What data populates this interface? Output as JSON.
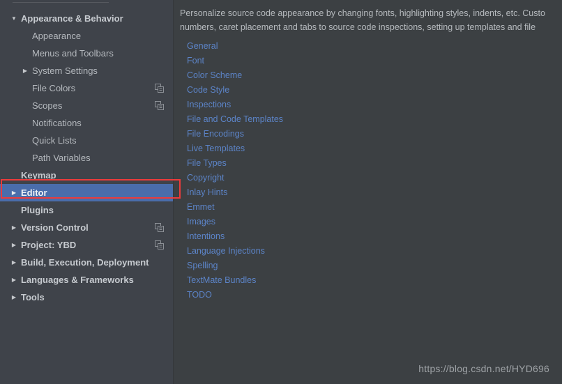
{
  "sidebar": {
    "items": [
      {
        "label": "Appearance & Behavior",
        "level": 0,
        "twisty": "down",
        "selected": false,
        "copy": false
      },
      {
        "label": "Appearance",
        "level": 1,
        "twisty": "none",
        "selected": false,
        "copy": false
      },
      {
        "label": "Menus and Toolbars",
        "level": 1,
        "twisty": "none",
        "selected": false,
        "copy": false
      },
      {
        "label": "System Settings",
        "level": 1,
        "twisty": "right",
        "selected": false,
        "copy": false
      },
      {
        "label": "File Colors",
        "level": 1,
        "twisty": "none",
        "selected": false,
        "copy": true
      },
      {
        "label": "Scopes",
        "level": 1,
        "twisty": "none",
        "selected": false,
        "copy": true
      },
      {
        "label": "Notifications",
        "level": 1,
        "twisty": "none",
        "selected": false,
        "copy": false
      },
      {
        "label": "Quick Lists",
        "level": 1,
        "twisty": "none",
        "selected": false,
        "copy": false
      },
      {
        "label": "Path Variables",
        "level": 1,
        "twisty": "none",
        "selected": false,
        "copy": false
      },
      {
        "label": "Keymap",
        "level": 0,
        "twisty": "none",
        "selected": false,
        "copy": false
      },
      {
        "label": "Editor",
        "level": 0,
        "twisty": "right",
        "selected": true,
        "copy": false
      },
      {
        "label": "Plugins",
        "level": 0,
        "twisty": "none",
        "selected": false,
        "copy": false
      },
      {
        "label": "Version Control",
        "level": 0,
        "twisty": "right",
        "selected": false,
        "copy": true
      },
      {
        "label": "Project: YBD",
        "level": 0,
        "twisty": "right",
        "selected": false,
        "copy": true
      },
      {
        "label": "Build, Execution, Deployment",
        "level": 0,
        "twisty": "right",
        "selected": false,
        "copy": false
      },
      {
        "label": "Languages & Frameworks",
        "level": 0,
        "twisty": "right",
        "selected": false,
        "copy": false
      },
      {
        "label": "Tools",
        "level": 0,
        "twisty": "right",
        "selected": false,
        "copy": false
      }
    ]
  },
  "main": {
    "description_line1": "Personalize source code appearance by changing fonts, highlighting styles, indents, etc. Custo",
    "description_line2": "numbers, caret placement and tabs to source code inspections, setting up templates and file ",
    "links": [
      "General",
      "Font",
      "Color Scheme",
      "Code Style",
      "Inspections",
      "File and Code Templates",
      "File Encodings",
      "Live Templates",
      "File Types",
      "Copyright",
      "Inlay Hints",
      "Emmet",
      "Images",
      "Intentions",
      "Language Injections",
      "Spelling",
      "TextMate Bundles",
      "TODO"
    ],
    "watermark": "https://blog.csdn.net/HYD696"
  },
  "colors": {
    "sidebar_bg": "#3f434a",
    "main_bg": "#3c4043",
    "selection_blue": "#4a6dab",
    "link_blue": "#5c84c8",
    "annotation_red": "#ec3b3b",
    "text_gray": "#b5b9be"
  }
}
